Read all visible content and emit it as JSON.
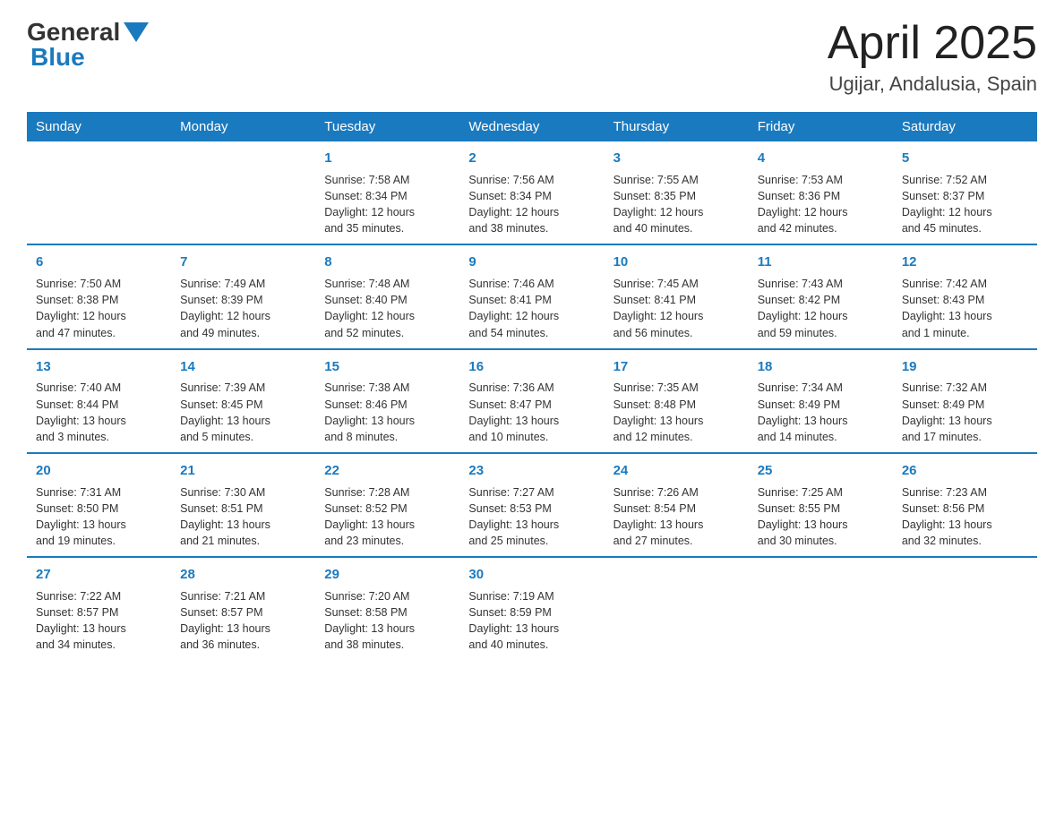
{
  "header": {
    "logo_general": "General",
    "logo_blue": "Blue",
    "month_title": "April 2025",
    "location": "Ugijar, Andalusia, Spain"
  },
  "weekdays": [
    "Sunday",
    "Monday",
    "Tuesday",
    "Wednesday",
    "Thursday",
    "Friday",
    "Saturday"
  ],
  "weeks": [
    [
      {
        "day": "",
        "info": ""
      },
      {
        "day": "",
        "info": ""
      },
      {
        "day": "1",
        "info": "Sunrise: 7:58 AM\nSunset: 8:34 PM\nDaylight: 12 hours\nand 35 minutes."
      },
      {
        "day": "2",
        "info": "Sunrise: 7:56 AM\nSunset: 8:34 PM\nDaylight: 12 hours\nand 38 minutes."
      },
      {
        "day": "3",
        "info": "Sunrise: 7:55 AM\nSunset: 8:35 PM\nDaylight: 12 hours\nand 40 minutes."
      },
      {
        "day": "4",
        "info": "Sunrise: 7:53 AM\nSunset: 8:36 PM\nDaylight: 12 hours\nand 42 minutes."
      },
      {
        "day": "5",
        "info": "Sunrise: 7:52 AM\nSunset: 8:37 PM\nDaylight: 12 hours\nand 45 minutes."
      }
    ],
    [
      {
        "day": "6",
        "info": "Sunrise: 7:50 AM\nSunset: 8:38 PM\nDaylight: 12 hours\nand 47 minutes."
      },
      {
        "day": "7",
        "info": "Sunrise: 7:49 AM\nSunset: 8:39 PM\nDaylight: 12 hours\nand 49 minutes."
      },
      {
        "day": "8",
        "info": "Sunrise: 7:48 AM\nSunset: 8:40 PM\nDaylight: 12 hours\nand 52 minutes."
      },
      {
        "day": "9",
        "info": "Sunrise: 7:46 AM\nSunset: 8:41 PM\nDaylight: 12 hours\nand 54 minutes."
      },
      {
        "day": "10",
        "info": "Sunrise: 7:45 AM\nSunset: 8:41 PM\nDaylight: 12 hours\nand 56 minutes."
      },
      {
        "day": "11",
        "info": "Sunrise: 7:43 AM\nSunset: 8:42 PM\nDaylight: 12 hours\nand 59 minutes."
      },
      {
        "day": "12",
        "info": "Sunrise: 7:42 AM\nSunset: 8:43 PM\nDaylight: 13 hours\nand 1 minute."
      }
    ],
    [
      {
        "day": "13",
        "info": "Sunrise: 7:40 AM\nSunset: 8:44 PM\nDaylight: 13 hours\nand 3 minutes."
      },
      {
        "day": "14",
        "info": "Sunrise: 7:39 AM\nSunset: 8:45 PM\nDaylight: 13 hours\nand 5 minutes."
      },
      {
        "day": "15",
        "info": "Sunrise: 7:38 AM\nSunset: 8:46 PM\nDaylight: 13 hours\nand 8 minutes."
      },
      {
        "day": "16",
        "info": "Sunrise: 7:36 AM\nSunset: 8:47 PM\nDaylight: 13 hours\nand 10 minutes."
      },
      {
        "day": "17",
        "info": "Sunrise: 7:35 AM\nSunset: 8:48 PM\nDaylight: 13 hours\nand 12 minutes."
      },
      {
        "day": "18",
        "info": "Sunrise: 7:34 AM\nSunset: 8:49 PM\nDaylight: 13 hours\nand 14 minutes."
      },
      {
        "day": "19",
        "info": "Sunrise: 7:32 AM\nSunset: 8:49 PM\nDaylight: 13 hours\nand 17 minutes."
      }
    ],
    [
      {
        "day": "20",
        "info": "Sunrise: 7:31 AM\nSunset: 8:50 PM\nDaylight: 13 hours\nand 19 minutes."
      },
      {
        "day": "21",
        "info": "Sunrise: 7:30 AM\nSunset: 8:51 PM\nDaylight: 13 hours\nand 21 minutes."
      },
      {
        "day": "22",
        "info": "Sunrise: 7:28 AM\nSunset: 8:52 PM\nDaylight: 13 hours\nand 23 minutes."
      },
      {
        "day": "23",
        "info": "Sunrise: 7:27 AM\nSunset: 8:53 PM\nDaylight: 13 hours\nand 25 minutes."
      },
      {
        "day": "24",
        "info": "Sunrise: 7:26 AM\nSunset: 8:54 PM\nDaylight: 13 hours\nand 27 minutes."
      },
      {
        "day": "25",
        "info": "Sunrise: 7:25 AM\nSunset: 8:55 PM\nDaylight: 13 hours\nand 30 minutes."
      },
      {
        "day": "26",
        "info": "Sunrise: 7:23 AM\nSunset: 8:56 PM\nDaylight: 13 hours\nand 32 minutes."
      }
    ],
    [
      {
        "day": "27",
        "info": "Sunrise: 7:22 AM\nSunset: 8:57 PM\nDaylight: 13 hours\nand 34 minutes."
      },
      {
        "day": "28",
        "info": "Sunrise: 7:21 AM\nSunset: 8:57 PM\nDaylight: 13 hours\nand 36 minutes."
      },
      {
        "day": "29",
        "info": "Sunrise: 7:20 AM\nSunset: 8:58 PM\nDaylight: 13 hours\nand 38 minutes."
      },
      {
        "day": "30",
        "info": "Sunrise: 7:19 AM\nSunset: 8:59 PM\nDaylight: 13 hours\nand 40 minutes."
      },
      {
        "day": "",
        "info": ""
      },
      {
        "day": "",
        "info": ""
      },
      {
        "day": "",
        "info": ""
      }
    ]
  ]
}
